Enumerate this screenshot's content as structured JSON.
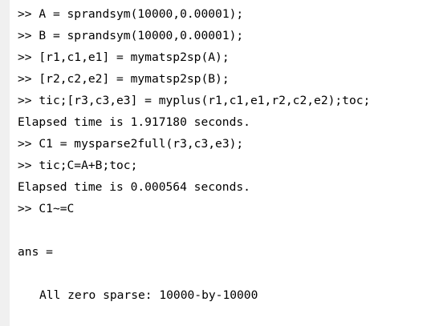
{
  "console": {
    "lines": [
      {
        "type": "command",
        "prompt": ">>",
        "text": "A = sprandsym(10000,0.00001);"
      },
      {
        "type": "command",
        "prompt": ">>",
        "text": "B = sprandsym(10000,0.00001);"
      },
      {
        "type": "command",
        "prompt": ">>",
        "text": "[r1,c1,e1] = mymatsp2sp(A);"
      },
      {
        "type": "command",
        "prompt": ">>",
        "text": "[r2,c2,e2] = mymatsp2sp(B);"
      },
      {
        "type": "command",
        "prompt": ">>",
        "text": "tic;[r3,c3,e3] = myplus(r1,c1,e1,r2,c2,e2);toc;"
      },
      {
        "type": "output",
        "text": "Elapsed time is 1.917180 seconds."
      },
      {
        "type": "command",
        "prompt": ">>",
        "text": "C1 = mysparse2full(r3,c3,e3);"
      },
      {
        "type": "command",
        "prompt": ">>",
        "text": "tic;C=A+B;toc;"
      },
      {
        "type": "output",
        "text": "Elapsed time is 0.000564 seconds."
      },
      {
        "type": "command",
        "prompt": ">>",
        "text": "C1~=C"
      },
      {
        "type": "blank",
        "text": ""
      },
      {
        "type": "output",
        "text": "ans ="
      },
      {
        "type": "blank",
        "text": ""
      },
      {
        "type": "output",
        "indent": true,
        "text": "All zero sparse: 10000-by-10000"
      }
    ]
  }
}
